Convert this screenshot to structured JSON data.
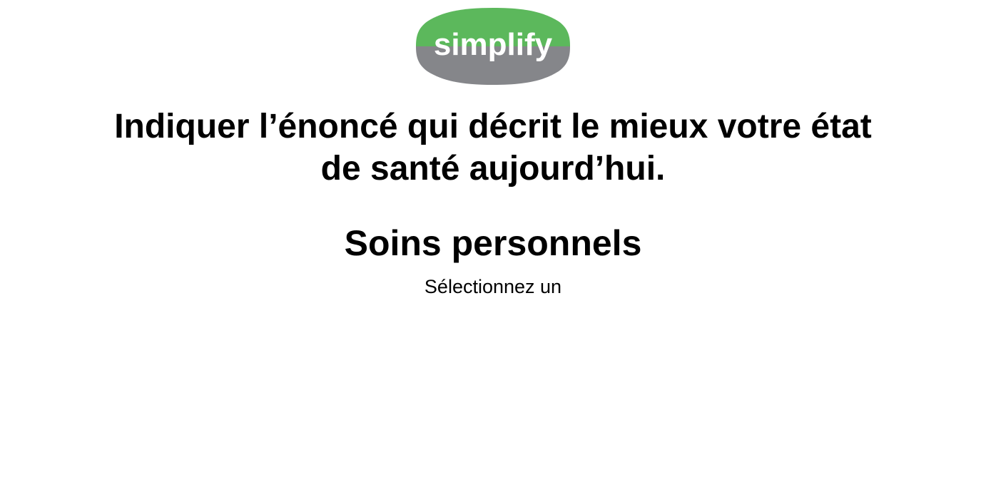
{
  "brand": {
    "logo_text": "simplify",
    "colors": {
      "green": "#5cb85c",
      "gray": "#85868a",
      "text": "#ffffff"
    }
  },
  "question": {
    "line1": "Indiquer l’énoncé qui décrit le mieux votre état",
    "line2": "de santé aujourd’hui."
  },
  "section": {
    "title": "Soins personnels",
    "instruction": "Sélectionnez un"
  }
}
